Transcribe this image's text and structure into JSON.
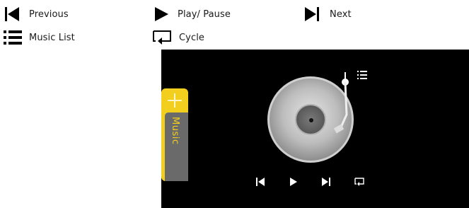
{
  "legend": {
    "previous": {
      "icon": "previous-icon",
      "label": "Previous"
    },
    "play_pause": {
      "icon": "play-icon",
      "label": "Play/ Pause"
    },
    "next": {
      "icon": "next-icon",
      "label": "Next"
    },
    "music_list": {
      "icon": "list-icon",
      "label": "Music List"
    },
    "cycle": {
      "icon": "cycle-icon",
      "label": "Cycle"
    }
  },
  "player": {
    "background": "#000000",
    "tab": {
      "label": "Music",
      "add_icon": "plus-icon",
      "accent": "#f2cf1f"
    },
    "disc_icon": "vinyl-record-icon",
    "arm_icon": "tonearm-icon",
    "list_icon": "list-icon",
    "controls": [
      "previous-icon",
      "play-icon",
      "next-icon",
      "cycle-icon"
    ]
  }
}
